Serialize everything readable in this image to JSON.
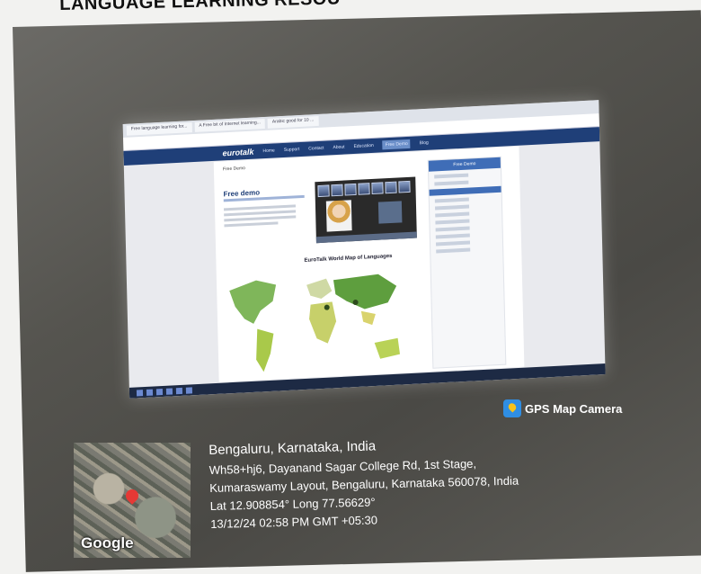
{
  "document": {
    "heading": "LANGUAGE LEARNING RESOU"
  },
  "screen": {
    "tabs": [
      "Free language learning for...",
      "A Free bit of Internet learning...",
      "Arabic good for 10 ..."
    ],
    "site": {
      "logo": "eurotalk",
      "nav": [
        "Home",
        "Support",
        "Contact",
        "About",
        "Education",
        "Free Demo",
        "Blog"
      ],
      "active_nav": "Free Demo",
      "breadcrumb": "Free Demo",
      "demo_title": "Free demo",
      "map_title": "EuroTalk World Map of Languages",
      "sidebar_header": "Free Demo"
    }
  },
  "gps": {
    "app_label": "GPS Map Camera",
    "map_brand": "Google",
    "city": "Bengaluru, Karnataka, India",
    "address_line1": "Wh58+hj6, Dayanand Sagar College Rd, 1st Stage,",
    "address_line2": "Kumaraswamy Layout, Bengaluru, Karnataka 560078, India",
    "coords": "Lat 12.908854° Long 77.56629°",
    "timestamp": "13/12/24 02:58 PM GMT +05:30"
  },
  "colors": {
    "nav_bar": "#1f3f78",
    "accent": "#3f6db7",
    "pin": "#e53935",
    "gps_icon": "#2f8ee4"
  }
}
